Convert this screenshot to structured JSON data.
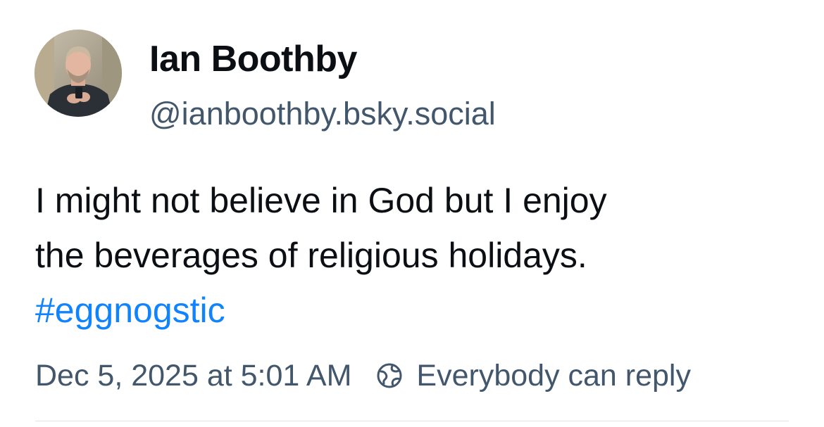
{
  "author": {
    "name": "Ian Boothby",
    "handle": "@ianboothby.bsky.social",
    "avatar_icon": "profile-photo"
  },
  "post": {
    "text_lines": [
      "I might not believe in God but I enjoy",
      "the beverages of religious holidays."
    ],
    "hashtag": "#eggnogstic"
  },
  "meta": {
    "timestamp": "Dec 5, 2025 at 5:01 AM",
    "reply_setting": "Everybody can reply",
    "reply_icon": "globe-earth-icon"
  },
  "colors": {
    "text": "#0b0f14",
    "muted": "#42576c",
    "link": "#1083fe",
    "divider": "#dfe4ea"
  }
}
